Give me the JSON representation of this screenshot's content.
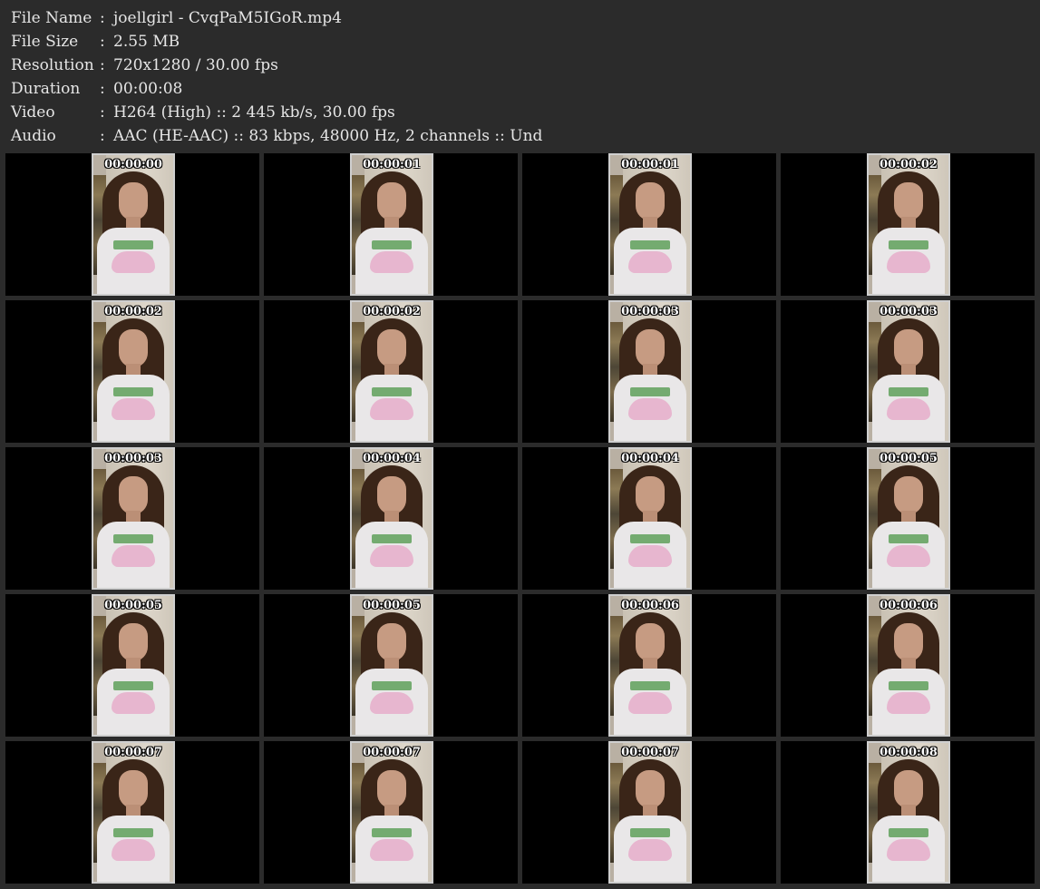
{
  "info": [
    {
      "key": "File Name",
      "colon": ":",
      "value": "joellgirl - CvqPaM5IGoR.mp4"
    },
    {
      "key": "File Size",
      "colon": ":",
      "value": "2.55 MB"
    },
    {
      "key": "Resolution",
      "colon": ":",
      "value": "720x1280 / 30.00 fps"
    },
    {
      "key": "Duration",
      "colon": ":",
      "value": "00:00:08"
    },
    {
      "key": "Video",
      "colon": ":",
      "value": "H264 (High) :: 2 445 kb/s, 30.00 fps"
    },
    {
      "key": "Audio",
      "colon": ":",
      "value": "AAC (HE-AAC) :: 83 kbps, 48000 Hz, 2 channels :: Und"
    }
  ],
  "thumbnails": [
    {
      "timestamp": "00:00:00"
    },
    {
      "timestamp": "00:00:01"
    },
    {
      "timestamp": "00:00:01"
    },
    {
      "timestamp": "00:00:02"
    },
    {
      "timestamp": "00:00:02"
    },
    {
      "timestamp": "00:00:02"
    },
    {
      "timestamp": "00:00:03"
    },
    {
      "timestamp": "00:00:03"
    },
    {
      "timestamp": "00:00:03"
    },
    {
      "timestamp": "00:00:04"
    },
    {
      "timestamp": "00:00:04"
    },
    {
      "timestamp": "00:00:05"
    },
    {
      "timestamp": "00:00:05"
    },
    {
      "timestamp": "00:00:05"
    },
    {
      "timestamp": "00:00:06"
    },
    {
      "timestamp": "00:00:06"
    },
    {
      "timestamp": "00:00:07"
    },
    {
      "timestamp": "00:00:07"
    },
    {
      "timestamp": "00:00:07"
    },
    {
      "timestamp": "00:00:08"
    }
  ]
}
